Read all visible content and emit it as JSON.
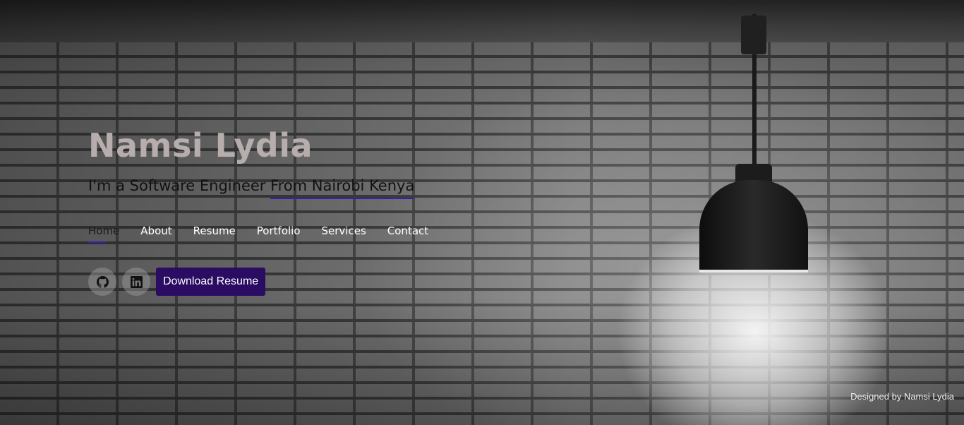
{
  "hero": {
    "name": "Namsi Lydia",
    "tagline_prefix": "I'm a Software Engineer ",
    "tagline_highlight": "From Nairobi Kenya"
  },
  "nav": {
    "items": [
      {
        "label": "Home",
        "active": true
      },
      {
        "label": "About"
      },
      {
        "label": "Resume"
      },
      {
        "label": "Portfolio"
      },
      {
        "label": "Services"
      },
      {
        "label": "Contact"
      }
    ]
  },
  "actions": {
    "github_icon": "github-icon",
    "linkedin_icon": "linkedin-icon",
    "download_label": "Download Resume"
  },
  "footer": {
    "credit": "Designed by Namsi Lydia"
  },
  "colors": {
    "accent": "#3e1ea6",
    "button_bg": "#2a0c63",
    "name_color": "#b7adad"
  }
}
